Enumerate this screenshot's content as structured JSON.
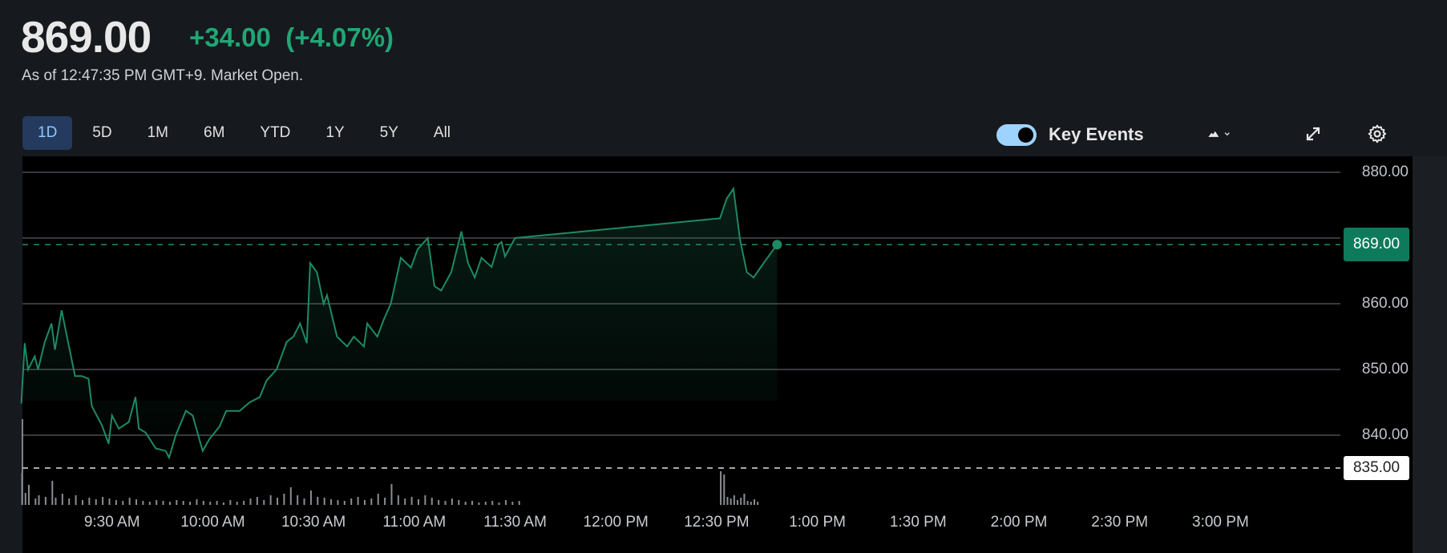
{
  "header": {
    "price": "869.00",
    "change": "+34.00",
    "change_pct": "(+4.07%)",
    "as_of": "As of 12:47:35 PM GMT+9. Market Open."
  },
  "ranges": [
    "1D",
    "5D",
    "1M",
    "6M",
    "YTD",
    "1Y",
    "5Y",
    "All"
  ],
  "active_range": "1D",
  "controls": {
    "key_events_label": "Key Events",
    "key_events_on": true,
    "chart_type_icon": "mountain-icon",
    "expand_icon": "expand-icon",
    "settings_icon": "gear-icon"
  },
  "colors": {
    "up": "#1fa774",
    "line": "#1e8a63",
    "badge": "#0e7a5c",
    "active_tab": "#243a5e"
  },
  "chart_data": {
    "type": "area",
    "title": "",
    "xlabel": "",
    "ylabel": "",
    "x_unit": "minutes since 9:00 AM",
    "ylim": [
      835,
      882
    ],
    "y_ticks": [
      "880.00",
      "860.00",
      "850.00",
      "840.00"
    ],
    "current_price_label": "869.00",
    "current_price": 869,
    "previous_close_label": "835.00",
    "previous_close": 835,
    "x_ticks": [
      "9:30 AM",
      "10:00 AM",
      "10:30 AM",
      "11:00 AM",
      "11:30 AM",
      "12:00 PM",
      "12:30 PM",
      "1:00 PM",
      "1:30 PM",
      "2:00 PM",
      "2:30 PM",
      "3:00 PM"
    ],
    "x_tick_minutes": [
      30,
      60,
      90,
      120,
      150,
      180,
      210,
      240,
      270,
      300,
      330,
      360
    ],
    "grid": true,
    "series": [
      {
        "name": "Price",
        "x": [
          3,
          4,
          5,
          7,
          8,
          10,
          12,
          13,
          15,
          17,
          19,
          21,
          23,
          24,
          27,
          29,
          30,
          32,
          35,
          37,
          38,
          40,
          43,
          46,
          47,
          49,
          52,
          54,
          57,
          59,
          62,
          64,
          68,
          71,
          74,
          76,
          79,
          82,
          84,
          86,
          88,
          89,
          91,
          93,
          94,
          97,
          100,
          102,
          105,
          106,
          109,
          111,
          113,
          116,
          119,
          121,
          124,
          126,
          128,
          131,
          134,
          136,
          138,
          140,
          143,
          145,
          146,
          147,
          150,
          211,
          213,
          215,
          217,
          219,
          221,
          224,
          228
        ],
        "y": [
          844.8,
          854,
          850,
          852,
          850,
          854.2,
          857,
          853,
          859,
          854,
          849,
          849,
          848.6,
          844.4,
          841.5,
          838.7,
          843,
          841,
          842,
          845.8,
          841,
          840.4,
          838,
          837.6,
          836.6,
          840,
          843.7,
          843,
          837.6,
          839.4,
          841.3,
          843.7,
          843.7,
          845,
          845.8,
          848.3,
          850,
          854.2,
          855,
          857,
          854,
          866.2,
          864.8,
          860,
          861.3,
          855,
          853.5,
          855,
          853.5,
          857,
          855,
          857.7,
          860,
          867,
          865.5,
          868.3,
          870,
          862.7,
          862,
          864.8,
          871,
          866.2,
          864,
          867,
          865.6,
          869,
          869.4,
          867.2,
          870,
          873,
          876,
          877.5,
          869.7,
          864.8,
          864,
          866.2,
          869
        ]
      }
    ],
    "volume": {
      "x": [
        3,
        4,
        5,
        7,
        8,
        10,
        12,
        13,
        15,
        17,
        19,
        21,
        23,
        25,
        27,
        29,
        31,
        33,
        35,
        37,
        39,
        41,
        43,
        45,
        47,
        49,
        51,
        53,
        55,
        57,
        59,
        61,
        63,
        65,
        67,
        69,
        71,
        73,
        75,
        77,
        79,
        81,
        83,
        85,
        87,
        89,
        91,
        93,
        95,
        97,
        99,
        101,
        103,
        105,
        107,
        109,
        111,
        113,
        115,
        117,
        119,
        121,
        123,
        125,
        127,
        129,
        131,
        133,
        135,
        137,
        139,
        141,
        143,
        145,
        147,
        149,
        151,
        211,
        212,
        213,
        214,
        215,
        216,
        217,
        218,
        219,
        220,
        221,
        222
      ],
      "y": [
        40,
        15,
        25,
        8,
        12,
        10,
        30,
        9,
        14,
        8,
        12,
        6,
        9,
        7,
        10,
        8,
        6,
        5,
        9,
        7,
        5,
        4,
        6,
        5,
        4,
        6,
        5,
        4,
        7,
        5,
        4,
        5,
        3,
        6,
        4,
        5,
        8,
        10,
        6,
        12,
        9,
        14,
        22,
        12,
        8,
        18,
        10,
        9,
        7,
        6,
        5,
        8,
        10,
        6,
        8,
        14,
        9,
        26,
        12,
        8,
        10,
        7,
        12,
        9,
        6,
        5,
        8,
        6,
        4,
        5,
        3,
        4,
        5,
        3,
        6,
        4,
        5,
        42,
        38,
        10,
        8,
        12,
        6,
        9,
        14,
        5,
        4,
        7,
        4
      ]
    }
  }
}
